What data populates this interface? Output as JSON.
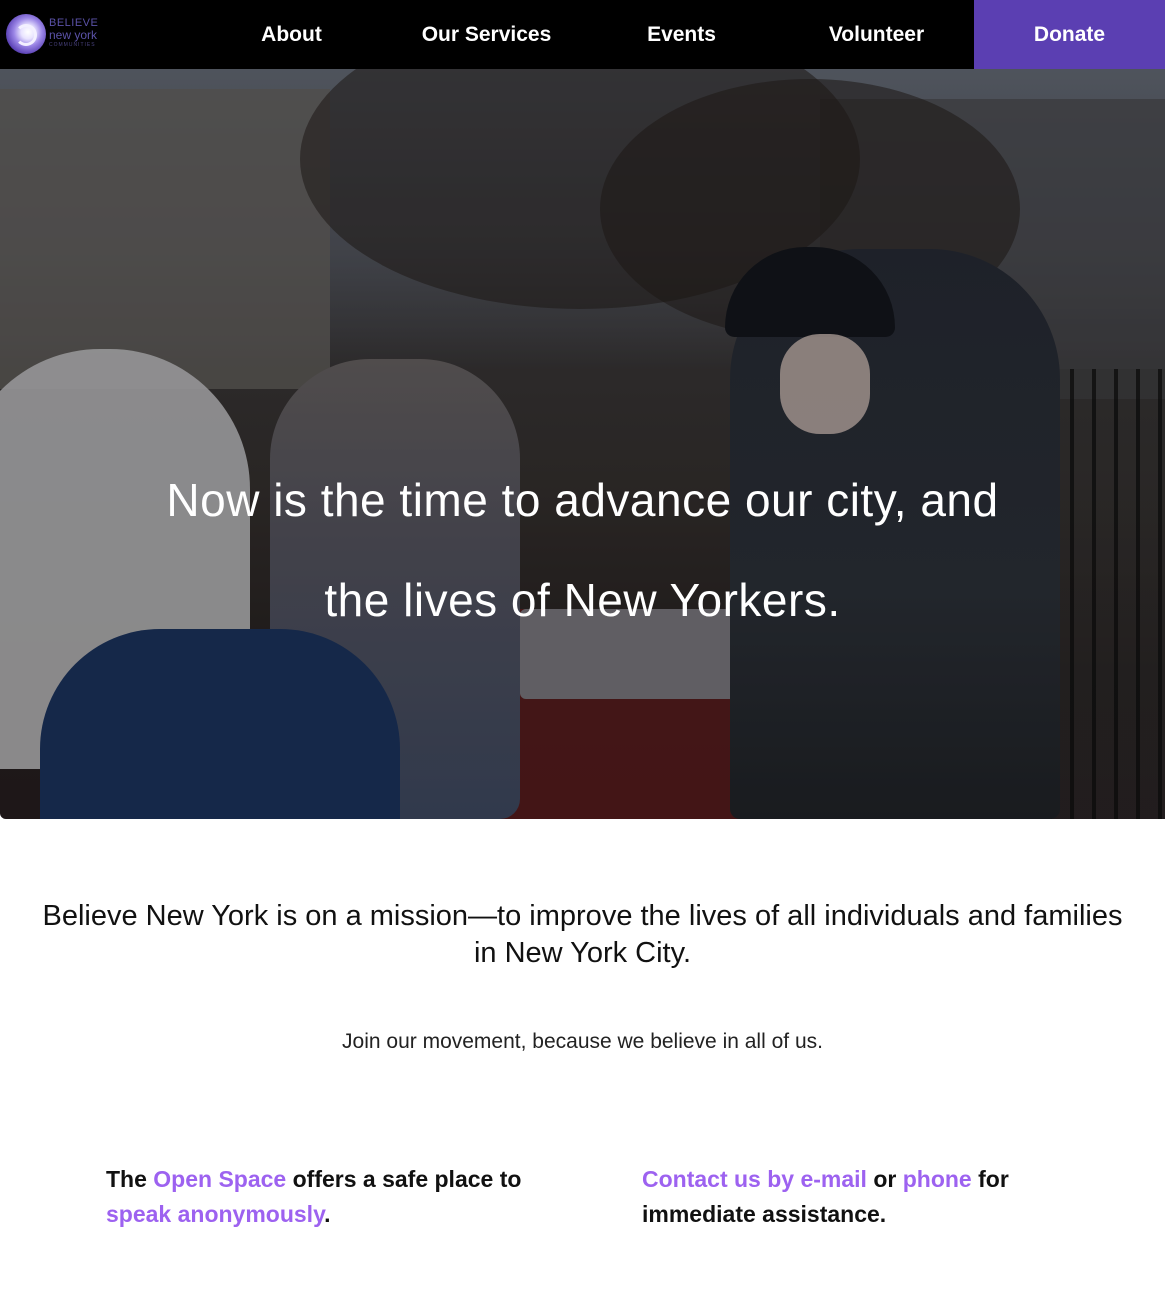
{
  "brand": {
    "logo_line1": "BELIEVE",
    "logo_line2": "new york",
    "logo_line3": "COMMUNITIES",
    "accent_color": "#5b3fb2",
    "link_color": "#9d62f0"
  },
  "nav": {
    "about": "About",
    "services": "Our Services",
    "events": "Events",
    "volunteer": "Volunteer",
    "donate": "Donate"
  },
  "hero": {
    "line1": "Now is the time to advance our city, and",
    "line2": "the lives of New Yorkers."
  },
  "mission": {
    "text": "Believe New York is on a mission—to improve the lives of all individuals and families in New York City.",
    "join": "Join our movement, because we believe in all of us."
  },
  "info_left": {
    "t1": "The ",
    "link1": "Open Space",
    "t2": " offers a safe place to ",
    "link2": "speak anonymously",
    "t3": "."
  },
  "info_right": {
    "link1": "Contact us by e-mail",
    "t1": " or ",
    "link2": "phone",
    "t2": " for immediate assistance."
  }
}
